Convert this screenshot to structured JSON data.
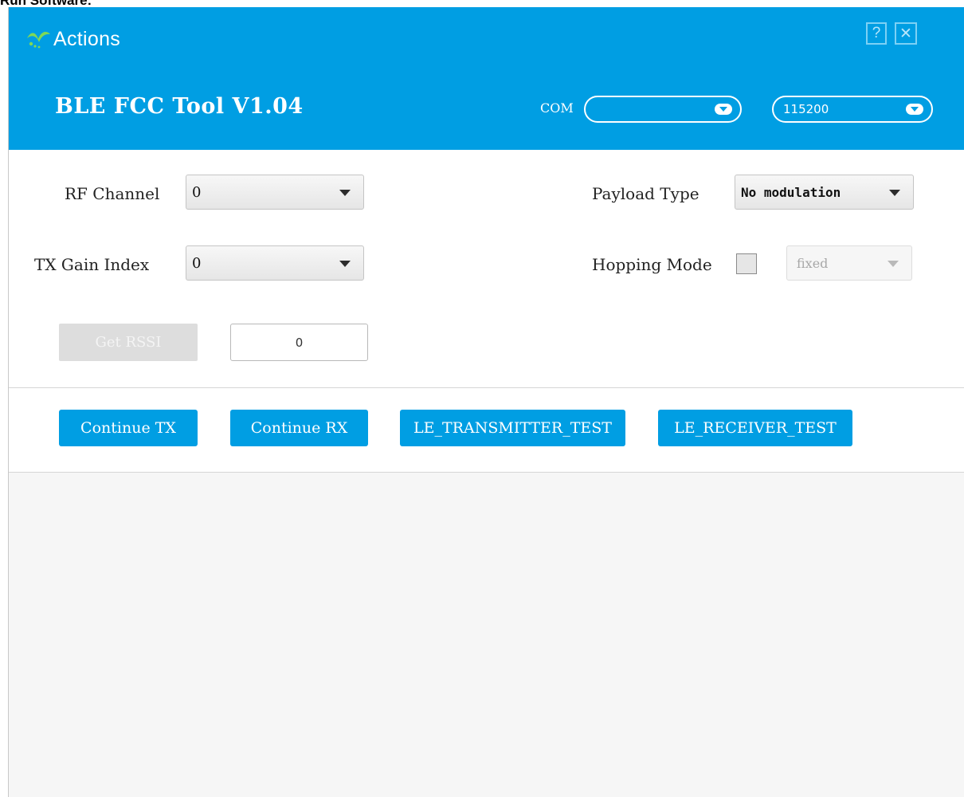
{
  "caption": "Run Software:",
  "header": {
    "logo_text": "Actions",
    "app_title": "BLE FCC Tool V1.04",
    "com_label": "COM",
    "com_value": "",
    "baud_value": "115200",
    "help_label": "?",
    "close_label": "✕",
    "background_color": "#009ee3"
  },
  "settings": {
    "rf_channel": {
      "label": "RF Channel",
      "value": "0"
    },
    "tx_gain_index": {
      "label": "TX Gain Index",
      "value": "0"
    },
    "payload_type": {
      "label": "Payload Type",
      "value": "No modulation"
    },
    "hopping_mode": {
      "label": "Hopping Mode",
      "checked": false,
      "value": "fixed"
    }
  },
  "rssi": {
    "button_label": "Get RSSI",
    "value": "0"
  },
  "actions": {
    "continue_tx": "Continue TX",
    "continue_rx": "Continue RX",
    "le_transmitter_test": "LE_TRANSMITTER_TEST",
    "le_receiver_test": "LE_RECEIVER_TEST"
  }
}
